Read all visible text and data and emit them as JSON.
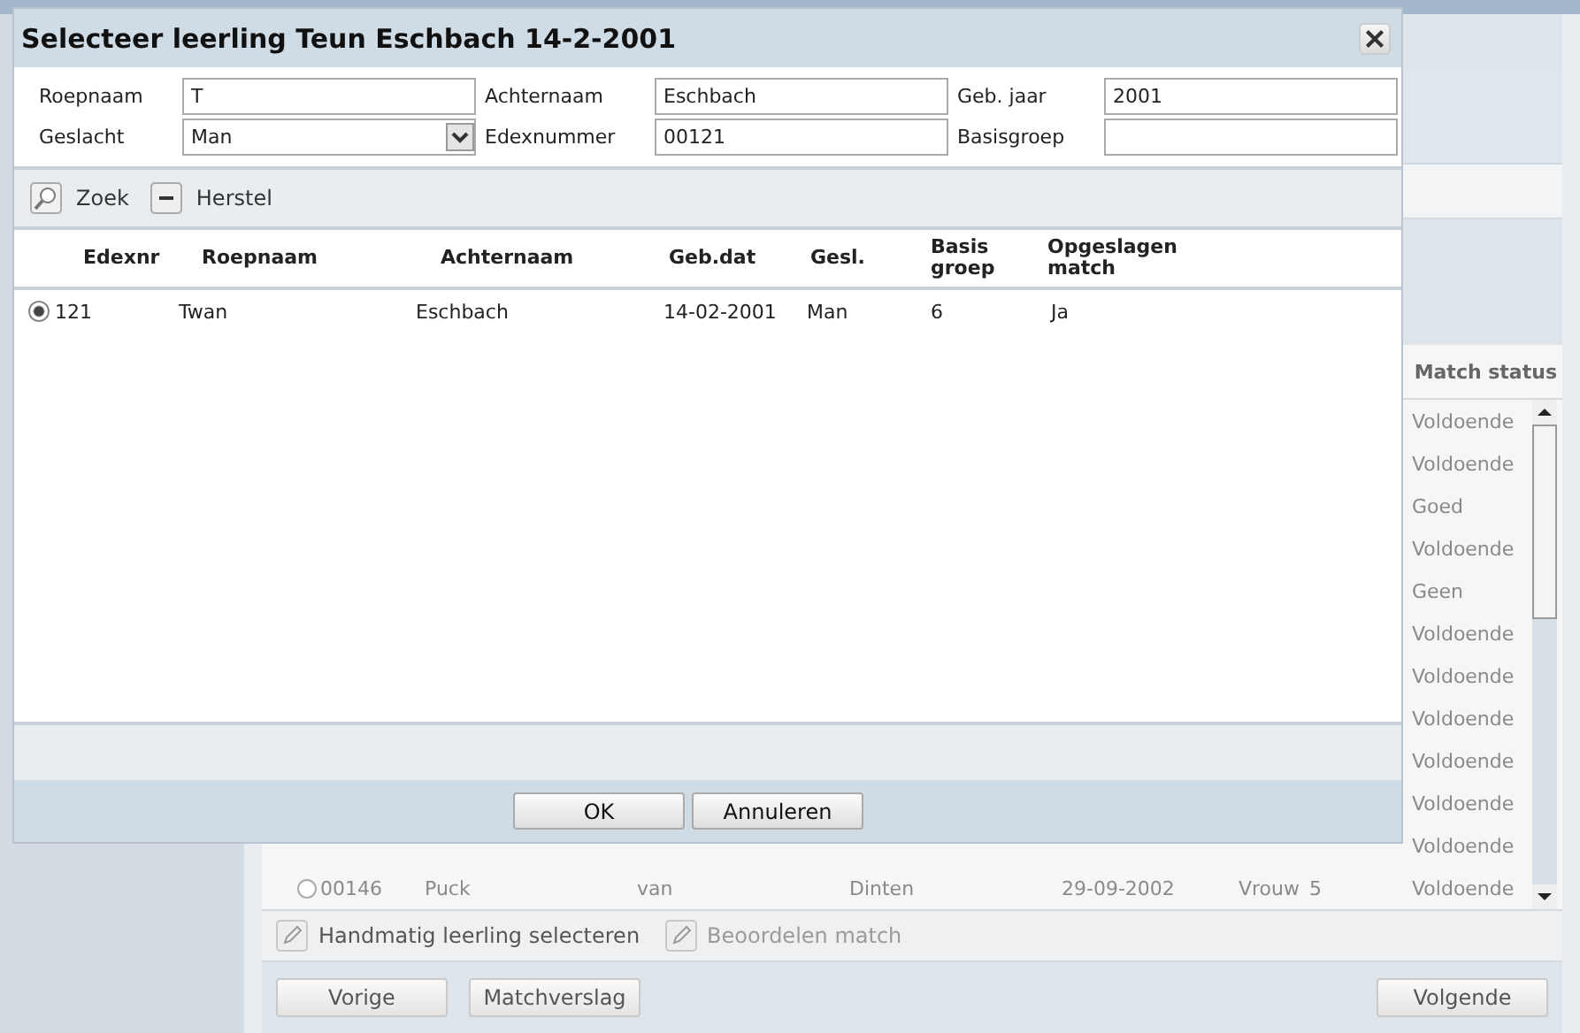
{
  "app": {
    "status_header": "Match status",
    "rows": [
      {
        "kind": "status",
        "status": "Voldoende"
      },
      {
        "kind": "status",
        "status": "Voldoende"
      },
      {
        "kind": "status",
        "status": "Goed"
      },
      {
        "kind": "status",
        "status": "Voldoende"
      },
      {
        "kind": "status",
        "status": "Geen"
      },
      {
        "kind": "status",
        "status": "Voldoende"
      },
      {
        "kind": "status",
        "status": "Voldoende"
      },
      {
        "kind": "status",
        "status": "Voldoende"
      },
      {
        "kind": "status",
        "status": "Voldoende"
      },
      {
        "kind": "status",
        "status": "Voldoende"
      },
      {
        "kind": "status",
        "status": "Voldoende"
      },
      {
        "kind": "full",
        "selected": false,
        "cells": [
          "00146",
          "Puck",
          "van",
          "Dinten",
          "29-09-2002",
          "Vrouw",
          "5"
        ],
        "status": "Voldoende"
      }
    ],
    "actions": [
      {
        "label": "Handmatig leerling selecteren",
        "disabled": false
      },
      {
        "label": "Beoordelen match",
        "disabled": true
      }
    ],
    "nav_left": [
      "Vorige",
      "Matchverslag"
    ],
    "nav_right": [
      "Volgende"
    ]
  },
  "dialog": {
    "title": "Selecteer leerling Teun Eschbach 14-2-2001",
    "form": [
      {
        "label": "Roepnaam",
        "kind": "text",
        "value": "T"
      },
      {
        "label": "Achternaam",
        "kind": "text",
        "value": "Eschbach"
      },
      {
        "label": "Geb. jaar",
        "kind": "text",
        "value": "2001"
      },
      {
        "label": "Geslacht",
        "kind": "select",
        "value": "Man"
      },
      {
        "label": "Edexnummer",
        "kind": "text",
        "value": "00121"
      },
      {
        "label": "Basisgroep",
        "kind": "text"
      }
    ],
    "toolbar": [
      {
        "kind": "search",
        "label": "Zoek"
      },
      {
        "kind": "minus",
        "label": "Herstel"
      }
    ],
    "columns": [
      "Edexnr",
      "Roepnaam",
      "Achternaam",
      "Geb.dat",
      "Gesl.",
      "Basis groep",
      "Opgeslagen match"
    ],
    "rows": [
      {
        "selected": true,
        "cells": [
          "121",
          "Twan",
          "Eschbach",
          "14-02-2001",
          "Man",
          "6",
          "Ja"
        ]
      }
    ],
    "buttons": [
      "OK",
      "Annuleren"
    ]
  }
}
